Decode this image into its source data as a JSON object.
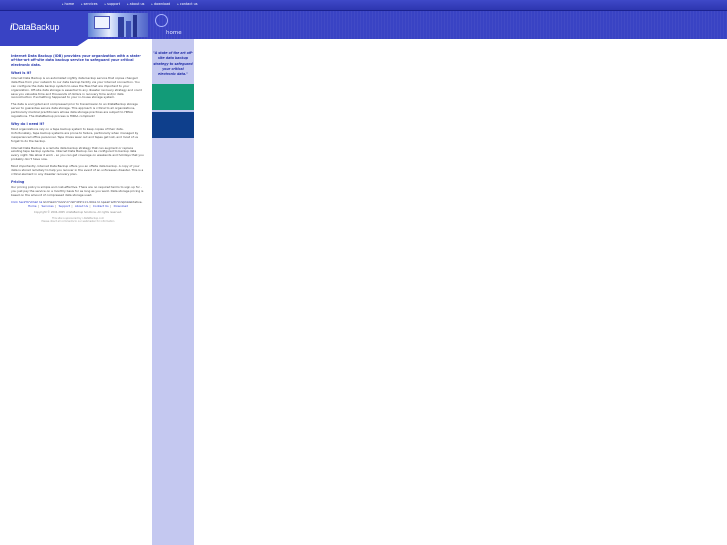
{
  "nav": [
    {
      "label": "home"
    },
    {
      "label": "services"
    },
    {
      "label": "support"
    },
    {
      "label": "about us"
    },
    {
      "label": "download"
    },
    {
      "label": "contact us"
    }
  ],
  "banner": {
    "logo_prefix": "i",
    "logo_text": "DataBackup",
    "page_label": "home"
  },
  "sidebar": {
    "quote": "\"A state of the art off-site data backup strategy to safeguard your critical electronic data.\""
  },
  "content": {
    "intro": "Internet Data Backup (IDB) provides your organization with a state-of-the-art off-site data backup service to safeguard your critical electronic data.",
    "what_heading": "What is it?",
    "what_p1": "Internet Data Backup is an automated nightly data backup service that copies changed data files from your network to our data backup facility via your Internet connection. You can configure the data backup system to save the files that are important to your organization. Off-site data storage is essential to any disaster recovery strategy and could save you valuable time and thousands of dollars in recovery time and/or data reconstruction if something happened to your in-house storage system.",
    "what_p2": "The data is encrypted and compressed prior to transmission to an iDataBackup storage server to guarantee secure data storage. This approach is critical to all organizations, particularly medical practitioners whose data storage practices are subject to HIPAA regulations. The iDataBackup process is HIPAA compliant!",
    "why_heading": "Why do I need it?",
    "why_p1": "Most organizations rely on a tape backup system to keep copies of their data. Unfortunately, tape backup systems are prone to failure, particularly when managed by inexperienced office personnel. Tape drives wear out and tapes get lost, and most of us forget to do the backup.",
    "why_p2": "Internet Data Backup is a remote data backup strategy that can augment or replace existing tape backup systems. Internet Data Backup can be configured to backup data every night. We allow it work - so you can get coverage on weekends and holidays that you probably don't have now.",
    "why_p3": "Most importantly, Internet Data Backup offers you an offsite data backup. A copy of your data is stored remotely to help you recover in the event of an unforeseen disaster. This is a critical element in any disaster recovery plan.",
    "pricing_heading": "Pricing",
    "pricing_p1": "Our pricing policy is simple and cost-effective. There are no required terms to sign up for - you just pay the service on a monthly basis for as long as you want. Data storage pricing is based on the amount of compressed data storage used.",
    "contact_link": "Click here to email us",
    "contact_rest": " and learn more or call 412-533-9044 to speak with a representative."
  },
  "footer": {
    "links": [
      "Home",
      "Services",
      "Support",
      "About Us",
      "Contact Us",
      "Download"
    ],
    "copyright": "Copyright © 2004-2005 i-DataBackup Solutions. All rights reserved.",
    "credit_line1": "This site is sponsored by i-DataBackup.com",
    "credit_line2": "Please direct all comments to our webmaster for information"
  },
  "colors": {
    "nav_bg": "#3f49c8",
    "sidebar_bg": "#c4c8f0",
    "green_box": "#129b78",
    "blue_box": "#0e3f8c",
    "heading": "#3040b0"
  }
}
